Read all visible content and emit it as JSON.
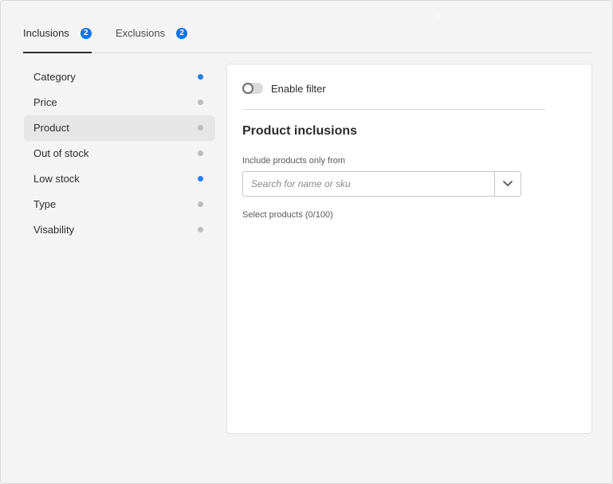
{
  "stray_mark": "1",
  "tabs": [
    {
      "label": "Inclusions",
      "badge": "2",
      "active": true
    },
    {
      "label": "Exclusions",
      "badge": "2",
      "active": false
    }
  ],
  "sidebar": {
    "items": [
      {
        "label": "Category",
        "status": "active"
      },
      {
        "label": "Price",
        "status": "inactive"
      },
      {
        "label": "Product",
        "status": "inactive",
        "selected": true
      },
      {
        "label": "Out of stock",
        "status": "inactive"
      },
      {
        "label": "Low stock",
        "status": "active"
      },
      {
        "label": "Type",
        "status": "inactive"
      },
      {
        "label": "Visability",
        "status": "inactive"
      }
    ]
  },
  "panel": {
    "toggle_label": "Enable filter",
    "toggle_on": false,
    "title": "Product inclusions",
    "field_label": "Include products only from",
    "search_placeholder": "Search for name or sku",
    "select_count": "Select products (0/100)"
  },
  "colors": {
    "accent": "#1473e6",
    "dot_active": "#2680eb",
    "dot_inactive": "#bdbdbd"
  },
  "icons": {
    "dropdown": "chevron-down-icon"
  }
}
